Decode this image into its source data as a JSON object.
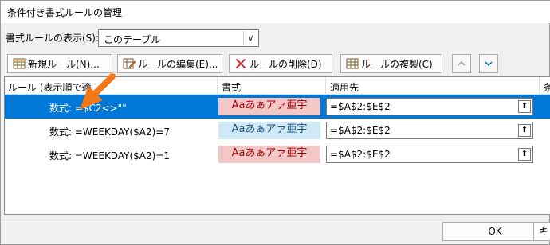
{
  "title": "条件付き書式ルールの管理",
  "show_rules": {
    "label": "書式ルールの表示(S):",
    "value": "このテーブル"
  },
  "toolbar": {
    "new_rule": "新規ルール(N)...",
    "edit_rule": "ルールの編集(E)...",
    "delete_rule": "ルールの削除(D)",
    "duplicate_rule": "ルールの複製(C)"
  },
  "columns": [
    "ルール (表示順で適",
    "書式",
    "適用先",
    "条"
  ],
  "rules": [
    {
      "rule": "数式: =$C2<>\"\"",
      "preview": "Aaあぁアァ亜宇",
      "applies_to": "=$A$2:$E$2",
      "preview_bg": "#f4c7c7",
      "preview_color": "#9c0006"
    },
    {
      "rule": "数式: =WEEKDAY($A2)=7",
      "preview": "Aaあぁアァ亜宇",
      "applies_to": "=$A$2:$E$2",
      "preview_bg": "#cfe9f7",
      "preview_color": "#1f4e79"
    },
    {
      "rule": "数式: =WEEKDAY($A2)=1",
      "preview": "Aaあぁアァ亜宇",
      "applies_to": "=$A$2:$E$2",
      "preview_bg": "#f4c7c7",
      "preview_color": "#9c0006"
    }
  ],
  "buttons": {
    "ok": "OK",
    "extra": "キ"
  },
  "colors": {
    "selection": "#0078d7",
    "arrow": "#f07818"
  }
}
